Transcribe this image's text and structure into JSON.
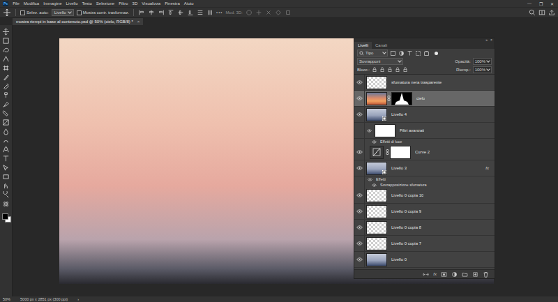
{
  "app_logo": "Ps",
  "menu_bar": {
    "items": [
      "File",
      "Modifica",
      "Immagine",
      "Livello",
      "Testo",
      "Selezione",
      "Filtro",
      "3D",
      "Visualizza",
      "Finestra",
      "Aiuto"
    ]
  },
  "window_controls": [
    "—",
    "❐",
    "✕"
  ],
  "options_bar": {
    "auto_select": {
      "label": "Selez. auto:",
      "checked": false
    },
    "target": "Livello",
    "show_transform": {
      "label": "Mostra contr. trasformaz.",
      "checked": false
    },
    "more": "•••",
    "mode_3d": {
      "label": "Mod. 3D:",
      "disabled": true
    }
  },
  "document_tab": {
    "title": "mostra riempi in base al contenuto.psd @ 50% (cielo, RGB/8) *",
    "close": "×",
    "selected": true
  },
  "layers_panel": {
    "header_controls": [
      "»",
      "×"
    ],
    "tabs": [
      {
        "label": "Livelli",
        "selected": true
      },
      {
        "label": "Canali",
        "selected": false
      }
    ],
    "filter": "Tipo",
    "blend_mode": "Sovrapponi",
    "opacity_label": "Opacità:",
    "opacity": "100%",
    "lock_label": "Blocc.:",
    "fill_label": "Riemp.:",
    "fill": "100%",
    "layers": [
      {
        "name": "sfumatura nera trasparente",
        "kind": "layer",
        "visible": true,
        "selected": false,
        "thumb": "transparent",
        "mask": null,
        "smart": false,
        "badge": null
      },
      {
        "name": "cielo",
        "kind": "layer",
        "visible": true,
        "selected": true,
        "thumb": "sky",
        "mask": "silhouette",
        "smart": false,
        "badge": null
      },
      {
        "name": "Livello 4",
        "kind": "layer",
        "visible": true,
        "selected": false,
        "thumb": "photo",
        "mask": null,
        "smart": true,
        "badge": null
      },
      {
        "name": "Filtri avanzati",
        "kind": "filters",
        "visible": true,
        "selected": false,
        "thumb": "white"
      },
      {
        "name": "Effetti di luce",
        "kind": "effect",
        "visible": true,
        "selected": false
      },
      {
        "name": "Curve 2",
        "kind": "layer",
        "visible": true,
        "selected": false,
        "thumb": "curves",
        "mask": "white",
        "smart": false,
        "badge": null
      },
      {
        "name": "Livello 3",
        "kind": "layer",
        "visible": true,
        "selected": false,
        "thumb": "photo",
        "mask": null,
        "smart": true,
        "badge": "fx"
      },
      {
        "name": "Effetti",
        "kind": "effect-group",
        "visible": true,
        "selected": false
      },
      {
        "name": "Sovrapposizione sfumatura",
        "kind": "effect",
        "visible": true,
        "selected": false
      },
      {
        "name": "Livello 0 copia 10",
        "kind": "layer",
        "visible": true,
        "selected": false,
        "thumb": "transparent",
        "mask": null,
        "smart": false,
        "badge": null
      },
      {
        "name": "Livello 0 copia 9",
        "kind": "layer",
        "visible": true,
        "selected": false,
        "thumb": "transparent",
        "mask": null,
        "smart": false,
        "badge": null
      },
      {
        "name": "Livello 0 copia 8",
        "kind": "layer",
        "visible": true,
        "selected": false,
        "thumb": "transparent",
        "mask": null,
        "smart": false,
        "badge": null
      },
      {
        "name": "Livello 0 copia 7",
        "kind": "layer",
        "visible": true,
        "selected": false,
        "thumb": "transparent",
        "mask": null,
        "smart": false,
        "badge": null
      },
      {
        "name": "Livello 0",
        "kind": "layer",
        "visible": true,
        "selected": false,
        "thumb": "photo",
        "mask": null,
        "smart": false,
        "badge": null
      }
    ],
    "footer_fx": "fx"
  },
  "status_bar": {
    "zoom": "50%",
    "doc_info": "5000 px x 2851 px (300 ppi)",
    "arrow": "›"
  }
}
